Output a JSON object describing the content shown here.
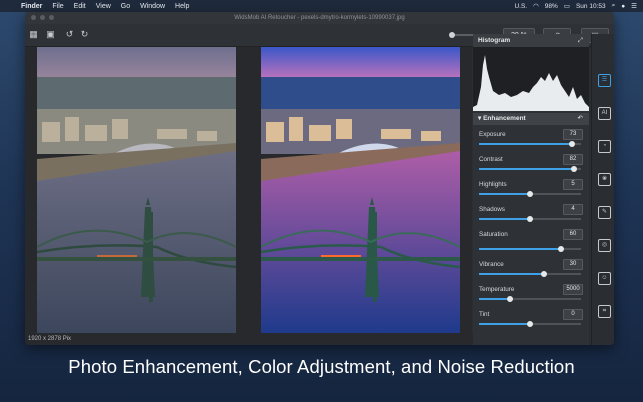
{
  "menubar": {
    "app_name": "Finder",
    "items": [
      "File",
      "Edit",
      "View",
      "Go",
      "Window",
      "Help"
    ],
    "status": {
      "locale": "U.S.",
      "battery": "98%",
      "clock": "Sun 10:53"
    }
  },
  "window": {
    "title": "WidsMob AI Retoucher - pexels-dmytro-kormylets-10990037.jpg"
  },
  "toolbar": {
    "zoom": "20 %"
  },
  "status_bar": {
    "dimensions": "1920 x 2878 Pix"
  },
  "panel": {
    "histogram_title": "Histogram",
    "enhancement_title": "Enhancement",
    "sliders": [
      {
        "label": "Exposure",
        "value": "73",
        "level": 0.91
      },
      {
        "label": "Contrast",
        "value": "82",
        "level": 0.93
      },
      {
        "label": "Highlights",
        "value": "5",
        "level": 0.5
      },
      {
        "label": "Shadows",
        "value": "4",
        "level": 0.5
      },
      {
        "label": "Saturation",
        "value": "60",
        "level": 0.8
      },
      {
        "label": "Vibrance",
        "value": "30",
        "level": 0.64
      },
      {
        "label": "Temperature",
        "value": "5000",
        "level": 0.3
      },
      {
        "label": "Tint",
        "value": "0",
        "level": 0.5
      }
    ]
  },
  "caption": "Photo Enhancement, Color Adjustment, and Noise Reduction"
}
